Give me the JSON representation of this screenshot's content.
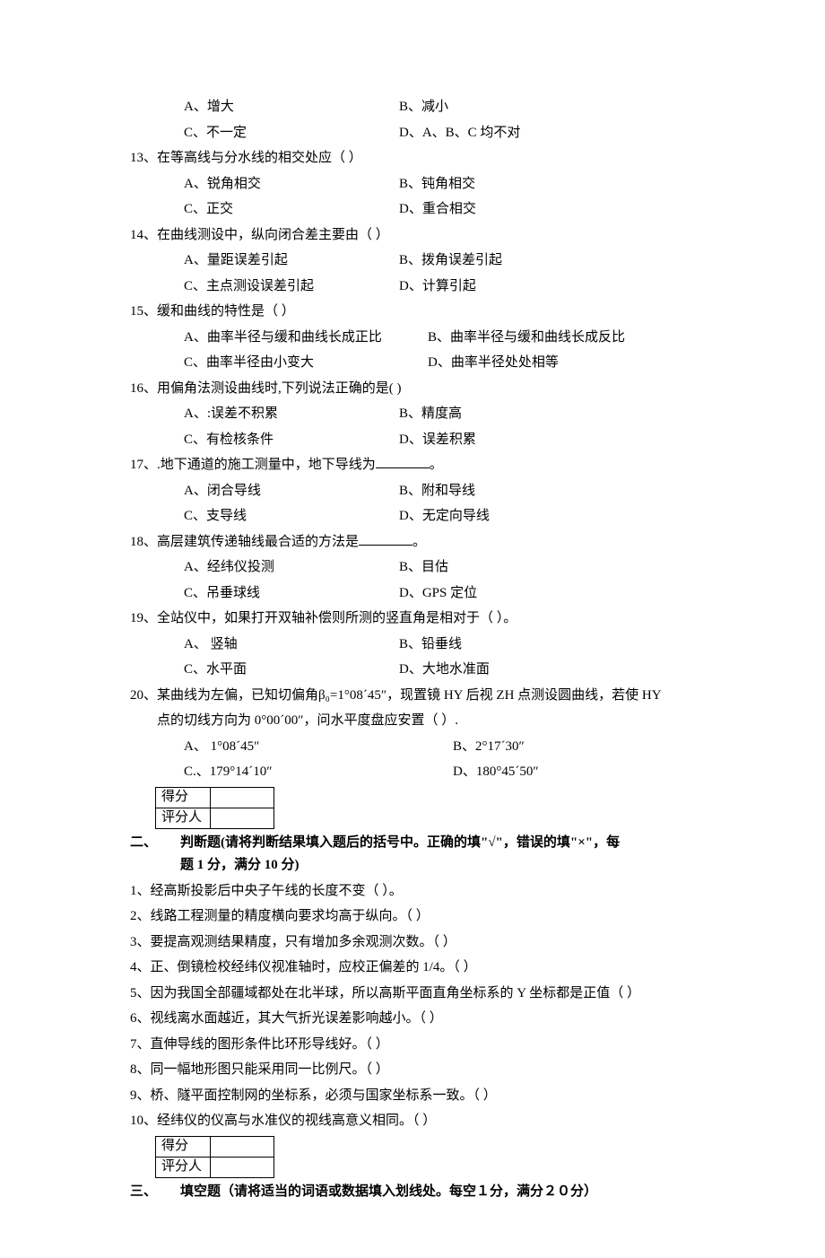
{
  "q12_opts": {
    "a": "A、增大",
    "b": "B、减小",
    "c": "C、不一定",
    "d": "D、A、B、C 均不对"
  },
  "q13": {
    "stem": "13、在等高线与分水线的相交处应（    ）",
    "a": "A、锐角相交",
    "b": "B、钝角相交",
    "c": "C、正交",
    "d": "D、重合相交"
  },
  "q14": {
    "stem": "14、在曲线测设中，纵向闭合差主要由（    ）",
    "a": "A、量距误差引起",
    "b": "B、拨角误差引起",
    "c": "C、主点测设误差引起",
    "d": "D、计算引起"
  },
  "q15": {
    "stem": "15、缓和曲线的特性是（    ）",
    "a": "A、曲率半径与缓和曲线长成正比",
    "b": "B、曲率半径与缓和曲线长成反比",
    "c": "C、曲率半径由小变大",
    "d": "D、曲率半径处处相等"
  },
  "q16": {
    "stem": "16、用偏角法测设曲线时,下列说法正确的是(    )",
    "a": "A、:误差不积累",
    "b": "B、精度高",
    "c": "C、有检核条件",
    "d": "D、误差积累"
  },
  "q17": {
    "pre": "17、.地下通道的施工测量中，地下导线为",
    "post": "。",
    "a": "A、闭合导线",
    "b": "B、附和导线",
    "c": "C、支导线",
    "d": "D、无定向导线"
  },
  "q18": {
    "pre": "18、高层建筑传递轴线最合适的方法是",
    "post": "。",
    "a": "A、经纬仪投测",
    "b": "B、目估",
    "c": "C、吊垂球线",
    "d": "D、GPS 定位"
  },
  "q19": {
    "stem": "19、全站仪中，如果打开双轴补偿则所测的竖直角是相对于（  ）。",
    "a": "A、 竖轴",
    "b": "B、铅垂线",
    "c": "C、水平面",
    "d": "D、大地水准面"
  },
  "q20": {
    "stem": "20、某曲线为左偏，已知切偏角β₀=1°08´45″，现置镜 HY 后视 ZH 点测设圆曲线，若使 HY",
    "cont": "点的切线方向为 0°00´00″，问水平度盘应安置（    ）.",
    "a": "A、 1°08´45″",
    "b": "B、2°17´30″",
    "c": "C.、179°14´10″",
    "d": "D、180°45´50″"
  },
  "score": {
    "row1": "得分",
    "row2": "评分人"
  },
  "sec2": {
    "num": "二、",
    "title": "判断题(请将判断结果填入题后的括号中。正确的填\"√\"，错误的填\"×\"，每",
    "sub": "题 1 分，满分 10 分)"
  },
  "tf": {
    "t1": "1、经高斯投影后中央子午线的长度不变（    ）。",
    "t2": "2、线路工程测量的精度横向要求均高于纵向。（    ）",
    "t3": "3、要提高观测结果精度，只有增加多余观测次数。（    ）",
    "t4": "4、正、倒镜检校经纬仪视准轴时，应校正偏差的 1/4。（    ）",
    "t5": "5、因为我国全部疆域都处在北半球，所以高斯平面直角坐标系的 Y 坐标都是正值（   ）",
    "t6": "6、视线离水面越近，其大气折光误差影响越小。（    ）",
    "t7": "7、直伸导线的图形条件比环形导线好。（    ）",
    "t8": "8、同一幅地形图只能采用同一比例尺。（    ）",
    "t9": "9、桥、隧平面控制网的坐标系，必须与国家坐标系一致。（    ）",
    "t10": "10、经纬仪的仪高与水准仪的视线高意义相同。（    ）"
  },
  "sec3": {
    "num": "三、",
    "title": "填空题（请将适当的词语或数据填入划线处。每空１分，满分２０分）"
  }
}
